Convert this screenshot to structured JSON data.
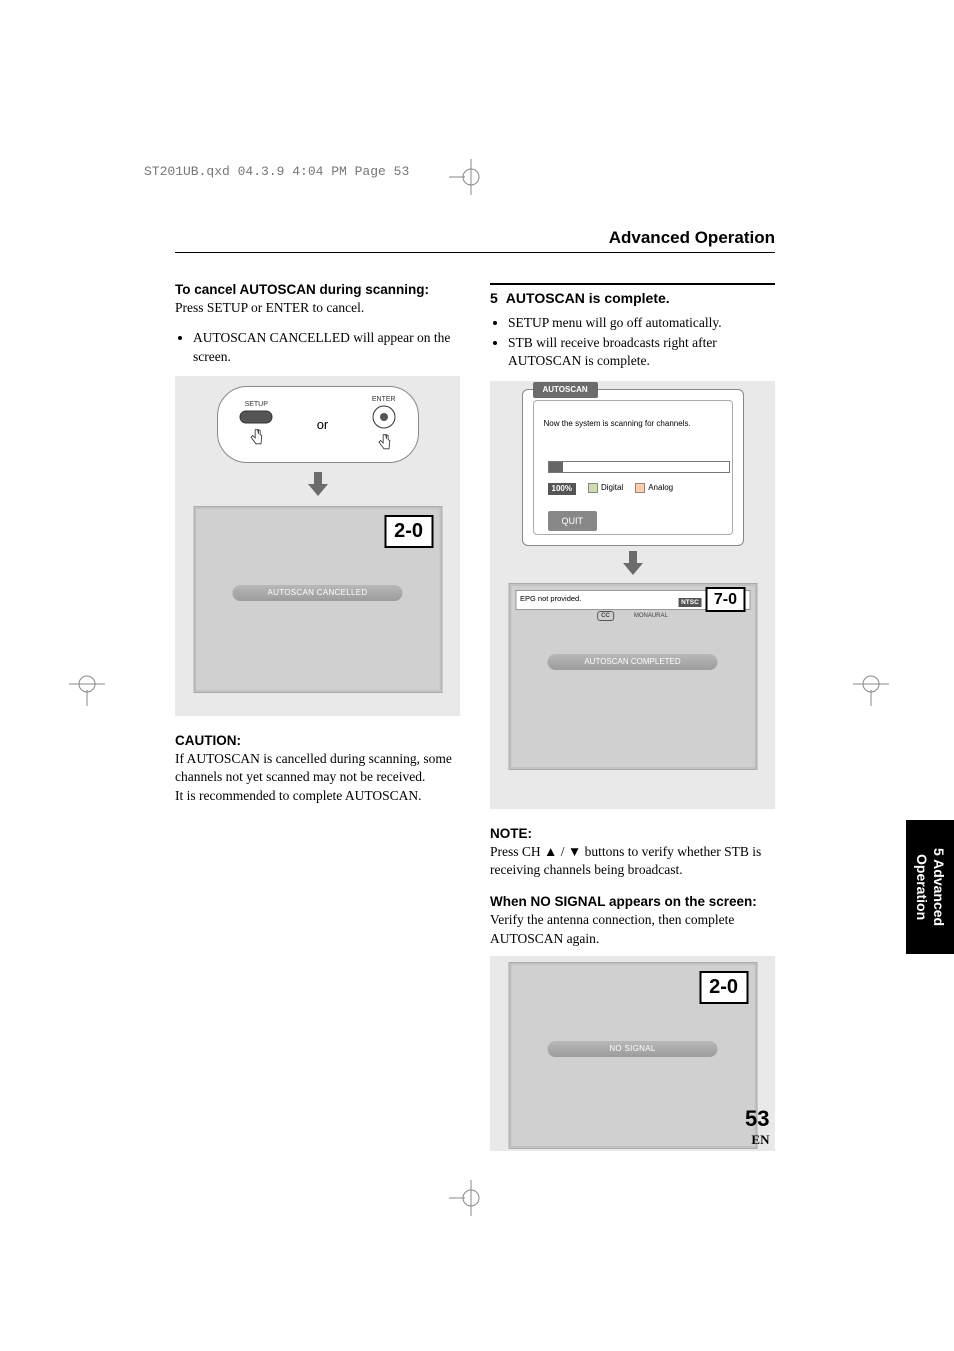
{
  "print_header": "ST201UB.qxd  04.3.9  4:04 PM  Page 53",
  "section_title": "Advanced Operation",
  "left": {
    "cancel_heading": "To cancel AUTOSCAN during scanning:",
    "cancel_body": "Press SETUP or ENTER to cancel.",
    "bullet1": "AUTOSCAN CANCELLED will appear on the screen.",
    "remote": {
      "setup_label": "SETUP",
      "enter_label": "ENTER",
      "or": "or"
    },
    "ch_cancel": "2-0",
    "banner_cancel": "AUTOSCAN CANCELLED",
    "caution_label": "CAUTION:",
    "caution_1": "If AUTOSCAN is cancelled during scanning, some channels not yet scanned may not be received.",
    "caution_2": "It is recommended to complete AUTOSCAN."
  },
  "right": {
    "step_num": "5",
    "step_txt": "AUTOSCAN is complete.",
    "bullet1": "SETUP menu will go off automatically.",
    "bullet2": "STB will receive broadcasts right after AUTOSCAN is complete.",
    "dlg": {
      "tab": "AUTOSCAN",
      "msg": "Now the system is scanning for channels.",
      "pct": "100%",
      "digital": "Digital",
      "analog": "Analog",
      "quit": "QUIT"
    },
    "ch_complete": "7-0",
    "info_epg": "EPG not provided.",
    "info_ntsc": "NTSC",
    "cc": "CC",
    "mono": "MONAURAL",
    "banner_complete": "AUTOSCAN COMPLETED",
    "note_label": "NOTE:",
    "note_body": "Press CH ▲ / ▼ buttons to verify whether STB is receiving channels being broadcast.",
    "nosignal_heading": "When NO SIGNAL appears on the screen:",
    "nosignal_body": "Verify the antenna connection, then complete AUTOSCAN again.",
    "ch_nosignal": "2-0",
    "banner_nosignal": "NO SIGNAL"
  },
  "side_tab": {
    "line1": "5 Advanced",
    "line2": "Operation"
  },
  "page_number": "53",
  "page_lang": "EN"
}
